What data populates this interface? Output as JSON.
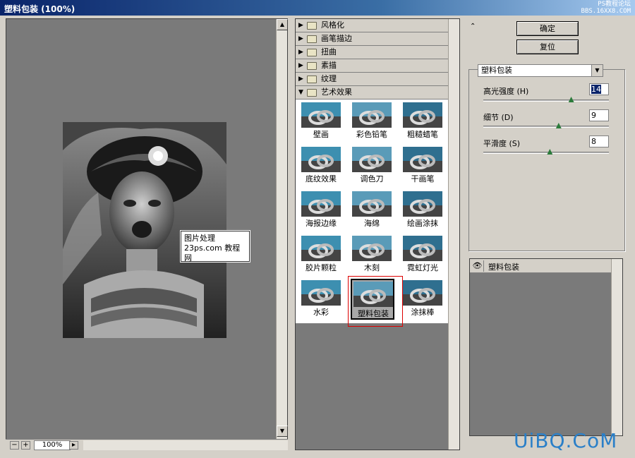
{
  "window": {
    "title": "塑料包装  (100%)",
    "watermark_line1": "PS教程论坛",
    "watermark_line2": "BBS.16XX8.COM"
  },
  "preview": {
    "overlay_line1": "图片处理",
    "overlay_line2": "23ps.com 教程网",
    "zoom": "100%"
  },
  "categories": [
    {
      "label": "风格化",
      "expanded": false
    },
    {
      "label": "画笔描边",
      "expanded": false
    },
    {
      "label": "扭曲",
      "expanded": false
    },
    {
      "label": "素描",
      "expanded": false
    },
    {
      "label": "纹理",
      "expanded": false
    },
    {
      "label": "艺术效果",
      "expanded": true
    }
  ],
  "filters": [
    {
      "label": "壁画"
    },
    {
      "label": "彩色铅笔"
    },
    {
      "label": "粗糙蜡笔"
    },
    {
      "label": "底纹效果"
    },
    {
      "label": "调色刀"
    },
    {
      "label": "干画笔"
    },
    {
      "label": "海报边缘"
    },
    {
      "label": "海绵"
    },
    {
      "label": "绘画涂抹"
    },
    {
      "label": "胶片颗粒"
    },
    {
      "label": "木刻"
    },
    {
      "label": "霓虹灯光"
    },
    {
      "label": "水彩"
    },
    {
      "label": "塑料包装"
    },
    {
      "label": "涂抹棒"
    }
  ],
  "selected_filter": "塑料包装",
  "buttons": {
    "ok": "确定",
    "reset": "复位"
  },
  "filter_select": {
    "value": "塑料包装"
  },
  "params": [
    {
      "label": "高光强度 (H)",
      "value": "14",
      "fraction": 0.7
    },
    {
      "label": "细节 (D)",
      "value": "9",
      "fraction": 0.6
    },
    {
      "label": "平滑度 (S)",
      "value": "8",
      "fraction": 0.53
    }
  ],
  "layer": {
    "name": "塑料包装"
  },
  "brand": "UiBQ.CoM"
}
